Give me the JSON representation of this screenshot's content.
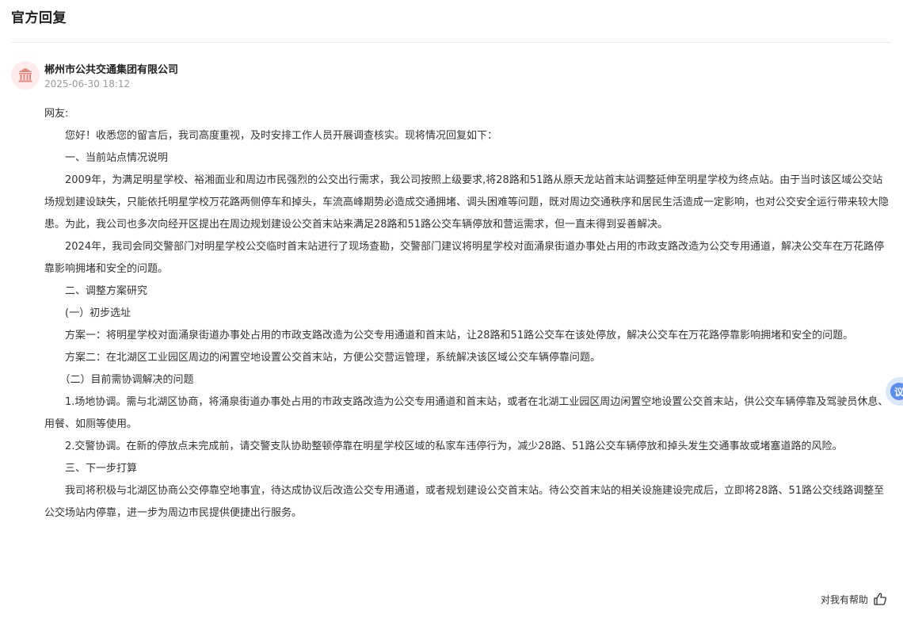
{
  "header": {
    "title": "官方回复"
  },
  "reply": {
    "avatar_icon": "government-building-icon",
    "org_name": "郴州市公共交通集团有限公司",
    "time": "2025-06-30 18:12",
    "paragraphs": [
      "网友:",
      "　　您好！收悉您的留言后，我司高度重视，及时安排工作人员开展调查核实。现将情况回复如下：",
      "　　一、当前站点情况说明",
      "　　2009年，为满足明星学校、裕湘面业和周边市民强烈的公交出行需求，我公司按照上级要求,将28路和51路从原天龙站首末站调整延伸至明星学校为终点站。由于当时该区域公交站场规划建设缺失，只能依托明星学校万花路两侧停车和掉头，车流高峰期势必造成交通拥堵、调头困难等问题，既对周边交通秩序和居民生活造成一定影响，也对公交安全运行带来较大隐患。为此，我公司也多次向经开区提出在周边规划建设公交首末站来满足28路和51路公交车辆停放和营运需求，但一直未得到妥善解决。",
      "　　2024年，我司会同交警部门对明星学校公交临时首末站进行了现场查勘，交警部门建议将明星学校对面涌泉街道办事处占用的市政支路改造为公交专用通道，解决公交车在万花路停靠影响拥堵和安全的问题。",
      "　　二、调整方案研究",
      "　　(一）初步选址",
      "　　方案一：将明星学校对面涌泉街道办事处占用的市政支路改造为公交专用通道和首末站，让28路和51路公交车在该处停放，解决公交车在万花路停靠影响拥堵和安全的问题。",
      "　　方案二：在北湖区工业园区周边的闲置空地设置公交首末站，方便公交营运管理，系统解决该区域公交车辆停靠问题。",
      "　　（二）目前需协调解决的问题",
      "　　1.场地协调。需与北湖区协商，将涌泉街道办事处占用的市政支路改造为公交专用通道和首末站，或者在北湖工业园区周边闲置空地设置公交首末站，供公交车辆停靠及驾驶员休息、用餐、如厕等使用。",
      "　　2.交警协调。在新的停放点未完成前，请交警支队协助整顿停靠在明星学校区域的私家车违停行为，减少28路、51路公交车辆停放和掉头发生交通事故或堵塞道路的风险。",
      "　　三、下一步打算",
      "　　我司将积极与北湖区协商公交停靠空地事宜，待达成协议后改造公交专用通道，或者规划建设公交首末站。待公交首末站的相关设施建设完成后，立即将28路、51路公交线路调整至公交场站内停靠，进一步为周边市民提供便捷出行服务。"
    ]
  },
  "footer": {
    "helpful_label": "对我有帮助",
    "helpful_icon": "thumbs-up-icon"
  },
  "side_widget": {
    "icon": "floating-side-tab-icon",
    "label": "议"
  }
}
